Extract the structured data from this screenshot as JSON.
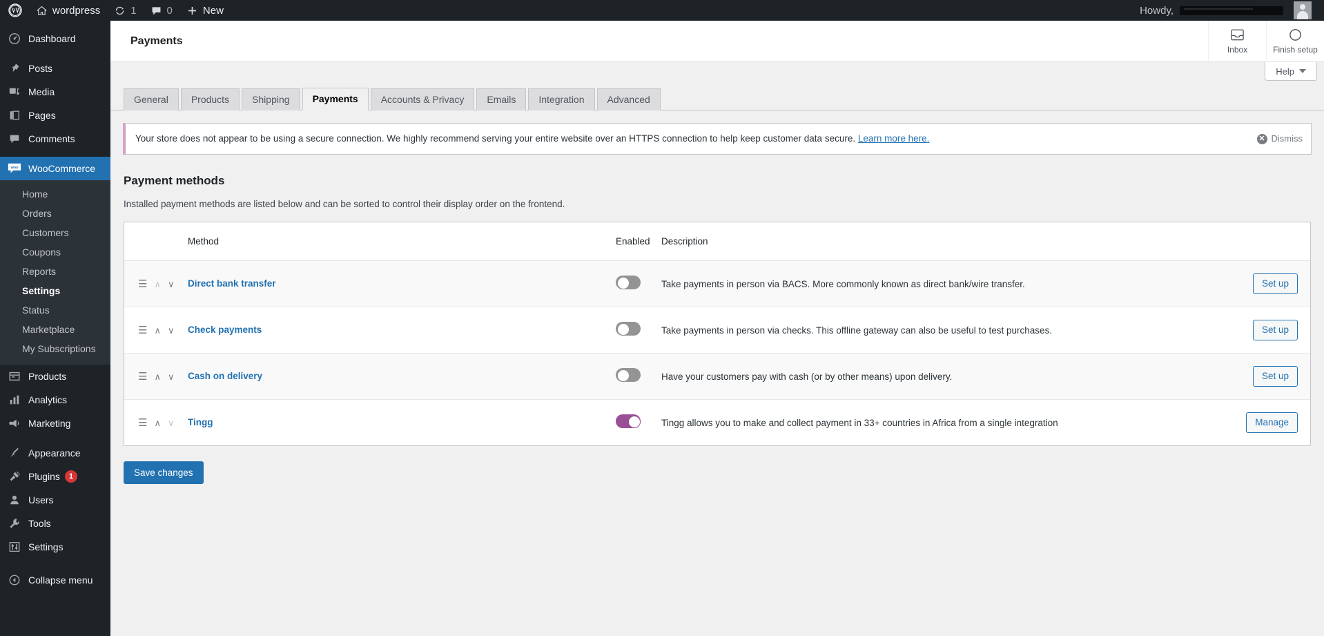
{
  "adminbar": {
    "wp_logo_icon": "wordpress-logo-icon",
    "site": {
      "label": "wordpress",
      "icon": "home-icon"
    },
    "updates": {
      "count": "1",
      "icon": "updates-icon"
    },
    "comments": {
      "count": "0",
      "icon": "comment-bubble-icon"
    },
    "new": {
      "label": "New",
      "icon": "plus-icon"
    },
    "howdy": "Howdy,",
    "user_name": "",
    "avatar_icon": "avatar-icon"
  },
  "sidebar": {
    "items": [
      {
        "label": "Dashboard",
        "icon": "dashboard-icon"
      },
      {
        "label": "Posts",
        "icon": "pin-icon"
      },
      {
        "label": "Media",
        "icon": "media-icon"
      },
      {
        "label": "Pages",
        "icon": "pages-icon"
      },
      {
        "label": "Comments",
        "icon": "comment-bubble-icon"
      },
      {
        "label": "WooCommerce",
        "icon": "woo-icon",
        "current": true
      },
      {
        "label": "Products",
        "icon": "products-icon"
      },
      {
        "label": "Analytics",
        "icon": "chart-bars-icon"
      },
      {
        "label": "Marketing",
        "icon": "megaphone-icon"
      },
      {
        "label": "Appearance",
        "icon": "paintbrush-icon"
      },
      {
        "label": "Plugins",
        "icon": "plug-icon",
        "badge": "1"
      },
      {
        "label": "Users",
        "icon": "user-icon"
      },
      {
        "label": "Tools",
        "icon": "wrench-icon"
      },
      {
        "label": "Settings",
        "icon": "sliders-icon"
      }
    ],
    "woo_submenu": [
      {
        "label": "Home"
      },
      {
        "label": "Orders"
      },
      {
        "label": "Customers"
      },
      {
        "label": "Coupons"
      },
      {
        "label": "Reports"
      },
      {
        "label": "Settings",
        "current": true
      },
      {
        "label": "Status"
      },
      {
        "label": "Marketplace"
      },
      {
        "label": "My Subscriptions"
      }
    ],
    "collapse": {
      "label": "Collapse menu",
      "icon": "collapse-arrow-icon"
    }
  },
  "header": {
    "title": "Payments",
    "actions": [
      {
        "label": "Inbox",
        "icon": "inbox-icon"
      },
      {
        "label": "Finish setup",
        "icon": "circle-progress-icon"
      }
    ],
    "help": {
      "label": "Help",
      "icon": "chevron-down-icon"
    }
  },
  "tabs": [
    {
      "label": "General",
      "active": false
    },
    {
      "label": "Products",
      "active": false
    },
    {
      "label": "Shipping",
      "active": false
    },
    {
      "label": "Payments",
      "active": true
    },
    {
      "label": "Accounts & Privacy",
      "active": false
    },
    {
      "label": "Emails",
      "active": false
    },
    {
      "label": "Integration",
      "active": false
    },
    {
      "label": "Advanced",
      "active": false
    }
  ],
  "notice": {
    "text": "Your store does not appear to be using a secure connection. We highly recommend serving your entire website over an HTTPS connection to help keep customer data secure.",
    "link_text": "Learn more here.",
    "dismiss_label": "Dismiss",
    "dismiss_icon": "close-circle-icon",
    "accent_color": "#d7a0c8"
  },
  "section": {
    "title": "Payment methods",
    "description": "Installed payment methods are listed below and can be sorted to control their display order on the frontend."
  },
  "table": {
    "columns": {
      "sort": "",
      "method": "Method",
      "enabled": "Enabled",
      "description": "Description",
      "action": ""
    },
    "rows": [
      {
        "name": "Direct bank transfer",
        "enabled": false,
        "description": "Take payments in person via BACS. More commonly known as direct bank/wire transfer.",
        "action_label": "Set up",
        "sort_up_disabled": true,
        "sort_down_disabled": false
      },
      {
        "name": "Check payments",
        "enabled": false,
        "description": "Take payments in person via checks. This offline gateway can also be useful to test purchases.",
        "action_label": "Set up",
        "sort_up_disabled": false,
        "sort_down_disabled": false
      },
      {
        "name": "Cash on delivery",
        "enabled": false,
        "description": "Have your customers pay with cash (or by other means) upon delivery.",
        "action_label": "Set up",
        "sort_up_disabled": false,
        "sort_down_disabled": false
      },
      {
        "name": "Tingg",
        "enabled": true,
        "description": "Tingg allows you to make and collect payment in 33+ countries in Africa from a single integration",
        "action_label": "Manage",
        "sort_up_disabled": false,
        "sort_down_disabled": true
      }
    ]
  },
  "footer": {
    "save_label": "Save changes"
  },
  "colors": {
    "admin_dark": "#1d2327",
    "admin_blue": "#2271b1",
    "toggle_on": "#9b4f96",
    "badge_red": "#d63638"
  }
}
